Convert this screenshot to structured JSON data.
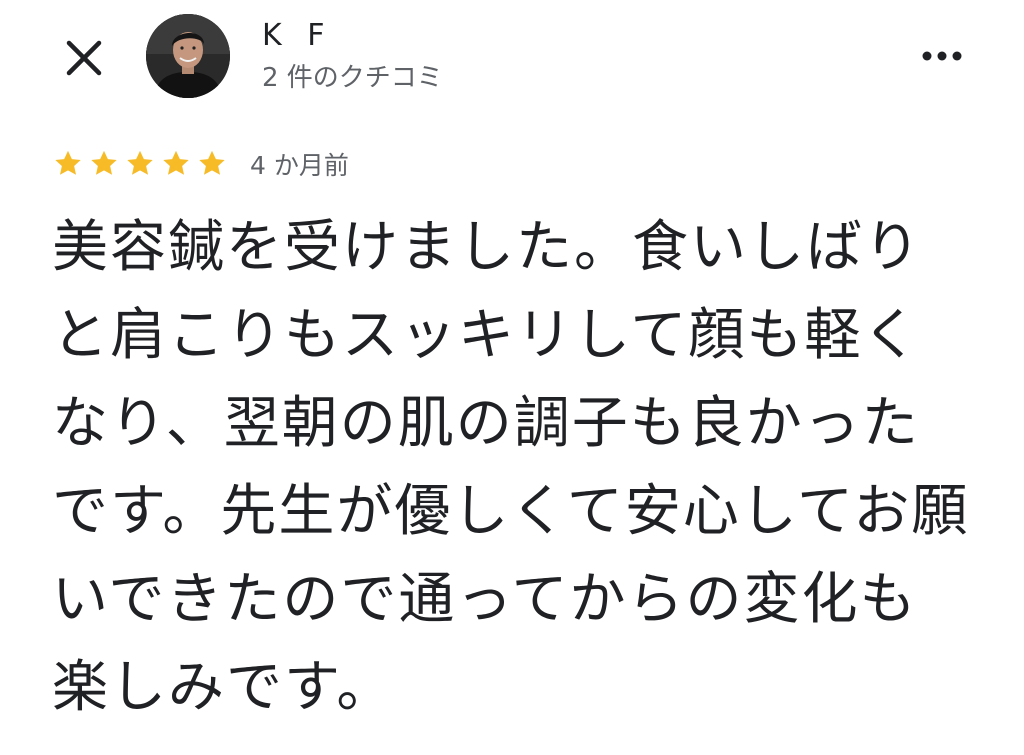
{
  "header": {
    "close_icon": "close-icon",
    "more_icon": "more-horizontal-icon",
    "author": {
      "name": "K F",
      "review_count": "2 件のクチコミ"
    }
  },
  "review": {
    "rating": 5,
    "rating_max": 5,
    "star_color": "#f6bb27",
    "time": "4 か月前",
    "text": "美容鍼を受けました。食いしばりと肩こりもスッキリして顔も軽くなり、翌朝の肌の調子も良かったです。先生が優しくて安心してお願いできたので通ってからの変化も楽しみです。"
  }
}
